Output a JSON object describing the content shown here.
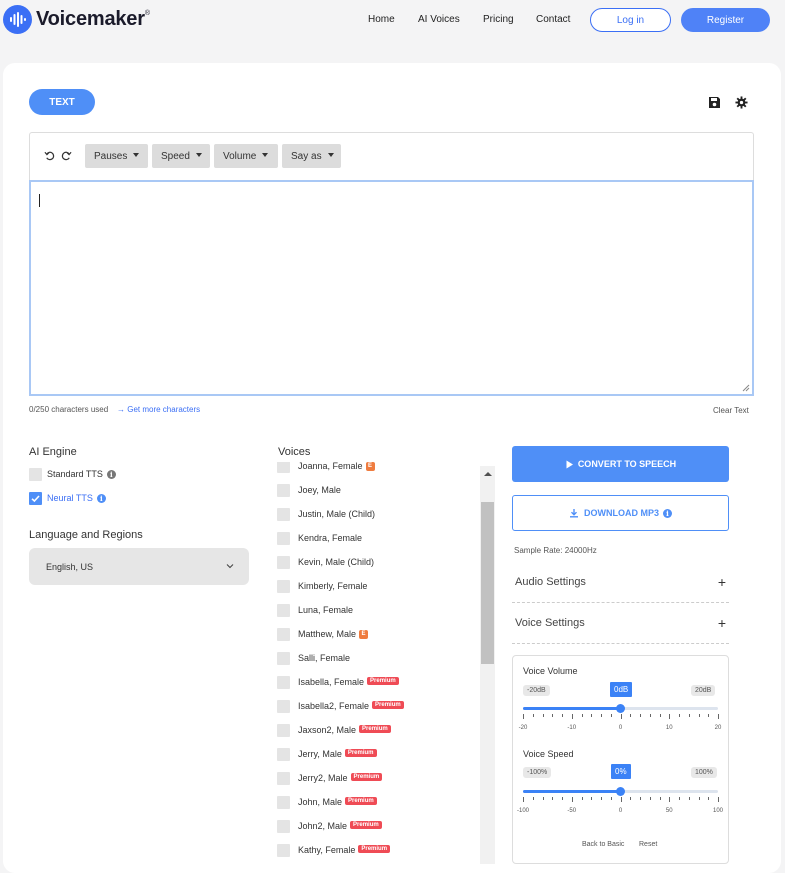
{
  "brand": {
    "name": "Voicemaker",
    "mark": "®"
  },
  "nav": {
    "links": [
      "Home",
      "AI Voices",
      "Pricing",
      "Contact"
    ],
    "login": "Log in",
    "register": "Register"
  },
  "editor": {
    "mode_button": "TEXT",
    "toolbar": [
      "Pauses",
      "Speed",
      "Volume",
      "Say as"
    ],
    "text_value": "",
    "chars_used": "0/250 characters used",
    "get_more": "→ Get more characters",
    "clear": "Clear Text"
  },
  "engine": {
    "title": "AI Engine",
    "options": [
      {
        "label": "Standard TTS",
        "checked": false
      },
      {
        "label": "Neural TTS",
        "checked": true
      }
    ]
  },
  "language": {
    "title": "Language and Regions",
    "selected": "English, US"
  },
  "voices": {
    "title": "Voices",
    "items": [
      {
        "label": "Joanna, Female",
        "badge": "E"
      },
      {
        "label": "Joey, Male",
        "badge": ""
      },
      {
        "label": "Justin, Male (Child)",
        "badge": ""
      },
      {
        "label": "Kendra, Female",
        "badge": ""
      },
      {
        "label": "Kevin, Male (Child)",
        "badge": ""
      },
      {
        "label": "Kimberly, Female",
        "badge": ""
      },
      {
        "label": "Luna, Female",
        "badge": ""
      },
      {
        "label": "Matthew, Male",
        "badge": "E"
      },
      {
        "label": "Salli, Female",
        "badge": ""
      },
      {
        "label": "Isabella, Female",
        "badge": "Premium"
      },
      {
        "label": "Isabella2, Female",
        "badge": "Premium"
      },
      {
        "label": "Jaxson2, Male",
        "badge": "Premium"
      },
      {
        "label": "Jerry, Male",
        "badge": "Premium"
      },
      {
        "label": "Jerry2, Male",
        "badge": "Premium"
      },
      {
        "label": "John, Male",
        "badge": "Premium"
      },
      {
        "label": "John2, Male",
        "badge": "Premium"
      },
      {
        "label": "Kathy, Female",
        "badge": "Premium"
      }
    ]
  },
  "actions": {
    "convert": "CONVERT TO SPEECH",
    "download": "DOWNLOAD MP3",
    "sample_rate": "Sample Rate: 24000Hz",
    "audio_settings": "Audio Settings",
    "voice_settings": "Voice Settings"
  },
  "voice_volume": {
    "title": "Voice Volume",
    "min_label": "-20dB",
    "max_label": "20dB",
    "value_label": "0dB",
    "value": 0,
    "min": -20,
    "max": 20,
    "tick_labels": [
      "-20",
      "-10",
      "0",
      "10",
      "20"
    ]
  },
  "voice_speed": {
    "title": "Voice Speed",
    "min_label": "-100%",
    "max_label": "100%",
    "value_label": "0%",
    "value": 0,
    "min": -100,
    "max": 100,
    "tick_labels": [
      "-100",
      "-50",
      "0",
      "50",
      "100"
    ]
  },
  "footer_links": {
    "back": "Back to Basic",
    "reset": "Reset"
  },
  "colors": {
    "accent": "#4f8ff7",
    "premium": "#ef4b55",
    "e_badge": "#ef7c3f"
  }
}
